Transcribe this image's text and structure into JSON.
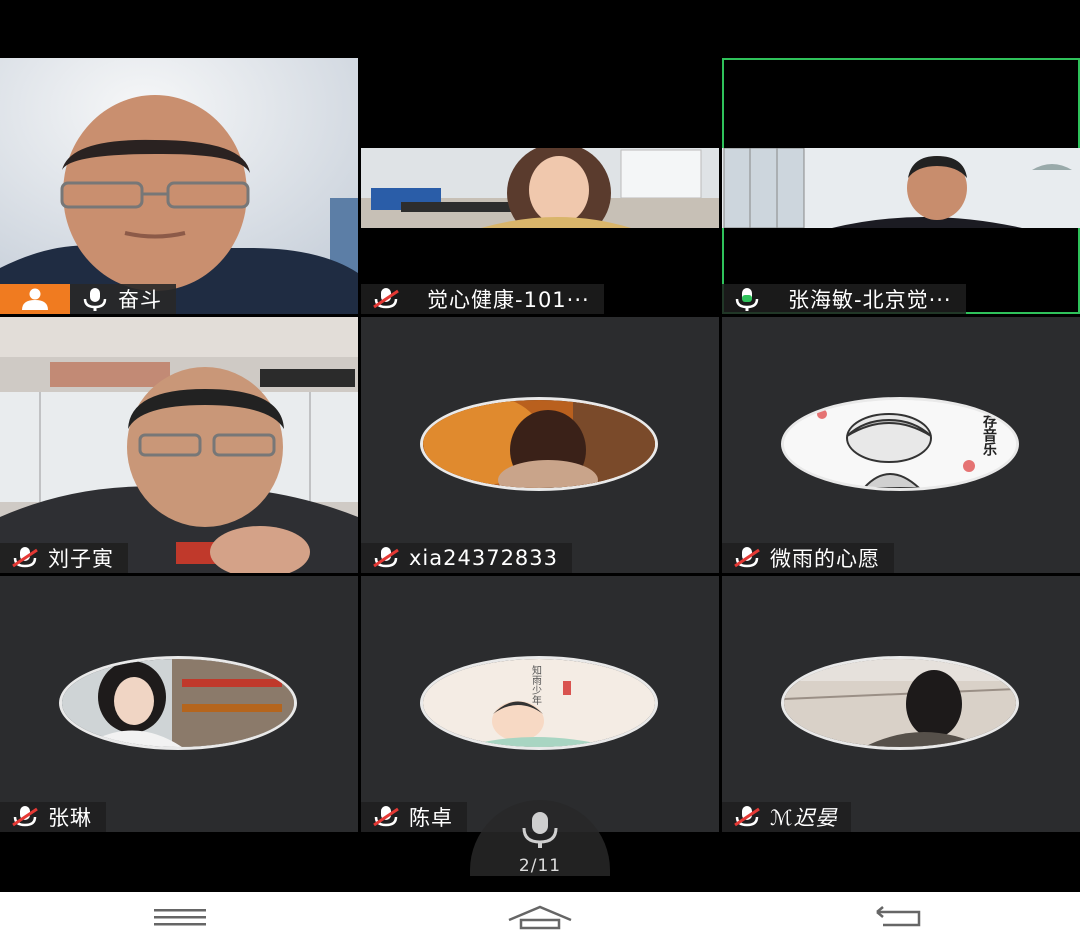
{
  "tiles": [
    {
      "name": "奋斗",
      "host": true,
      "mic": "on",
      "video": "full"
    },
    {
      "name": "觉心健康-101···",
      "mic": "muted",
      "video": "band"
    },
    {
      "name": "张海敏-北京觉···",
      "mic": "speaking",
      "video": "band",
      "active": true
    },
    {
      "name": "刘子寅",
      "mic": "muted",
      "video": "full"
    },
    {
      "name": "xia24372833",
      "mic": "muted",
      "video": "avatar"
    },
    {
      "name": "微雨的心愿",
      "mic": "muted",
      "video": "avatar"
    },
    {
      "name": "张琳",
      "mic": "muted",
      "video": "avatar"
    },
    {
      "name": "陈卓",
      "mic": "muted",
      "video": "avatar"
    },
    {
      "name": "ℳ迟晏",
      "mic": "muted",
      "video": "avatar"
    }
  ],
  "avatar_text": {
    "weiyu_top": "存音乐",
    "chenzhuo_top": "知雨少年"
  },
  "pager": {
    "label": "2/11"
  },
  "colors": {
    "host_badge": "#f07b20",
    "active_border": "#2fc25b",
    "muted_red": "#e53935",
    "speaking_green": "#2fc25b"
  },
  "icons": [
    "person-icon",
    "mic-icon",
    "mic-muted-icon",
    "menu-icon",
    "home-icon",
    "back-icon"
  ]
}
